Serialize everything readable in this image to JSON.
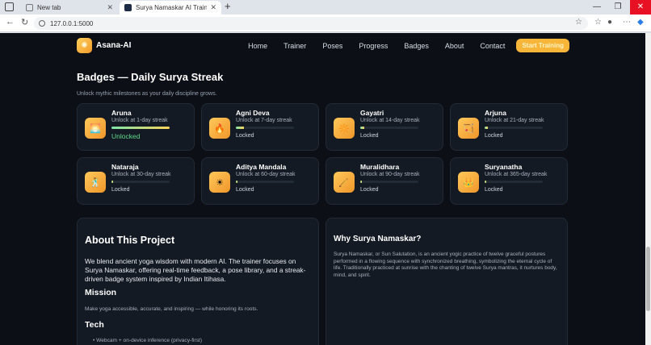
{
  "browser": {
    "tabs": [
      {
        "label": "New tab",
        "active": false
      },
      {
        "label": "Surya Namaskar AI Trainer — Ho",
        "active": true
      }
    ],
    "url": "127.0.0.1:5000"
  },
  "nav": {
    "brand": "Asana-AI",
    "logo_glyph": "✺",
    "links": [
      "Home",
      "Trainer",
      "Poses",
      "Progress",
      "Badges",
      "About",
      "Contact"
    ],
    "cta": "Start Training"
  },
  "badges": {
    "title": "Badges — Daily Surya Streak",
    "subtitle": "Unlock mythic milestones as your daily discipline grows.",
    "items": [
      {
        "name": "Aruna",
        "unlock": "Unlock at 1-day streak",
        "status": "Unlocked",
        "progress": 1.0,
        "icon": "🌅"
      },
      {
        "name": "Agni Deva",
        "unlock": "Unlock at 7-day streak",
        "status": "Locked",
        "progress": 0.14,
        "icon": "🔥"
      },
      {
        "name": "Gayatri",
        "unlock": "Unlock at 14-day streak",
        "status": "Locked",
        "progress": 0.07,
        "icon": "🔆"
      },
      {
        "name": "Arjuna",
        "unlock": "Unlock at 21-day streak",
        "status": "Locked",
        "progress": 0.05,
        "icon": "🏹"
      },
      {
        "name": "Nataraja",
        "unlock": "Unlock at 30-day streak",
        "status": "Locked",
        "progress": 0.03,
        "icon": "🕺"
      },
      {
        "name": "Aditya Mandala",
        "unlock": "Unlock at 60-day streak",
        "status": "Locked",
        "progress": 0.02,
        "icon": "☀"
      },
      {
        "name": "Muralidhara",
        "unlock": "Unlock at 90-day streak",
        "status": "Locked",
        "progress": 0.01,
        "icon": "🪈"
      },
      {
        "name": "Suryanatha",
        "unlock": "Unlock at 365-day streak",
        "status": "Locked",
        "progress": 0.01,
        "icon": "👑"
      }
    ]
  },
  "about": {
    "title": "About This Project",
    "body": "We blend ancient yoga wisdom with modern AI. The trainer focuses on Surya Namaskar, offering real-time feedback, a pose library, and a streak-driven badge system inspired by Indian Itihasa.",
    "mission_heading": "Mission",
    "mission_body": "Make yoga accessible, accurate, and inspiring — while honoring its roots.",
    "tech_heading": "Tech",
    "tech_items": [
      "Webcam + on-device inference (privacy-first)"
    ]
  },
  "why": {
    "title": "Why Surya Namaskar?",
    "body": "Surya Namaskar, or Sun Salutation, is an ancient yogic practice of twelve graceful postures performed in a flowing sequence with synchronized breathing, symbolizing the eternal cycle of life. Traditionally practiced at sunrise with the chanting of twelve Surya mantras, it nurtures body, mind, and spirit."
  }
}
